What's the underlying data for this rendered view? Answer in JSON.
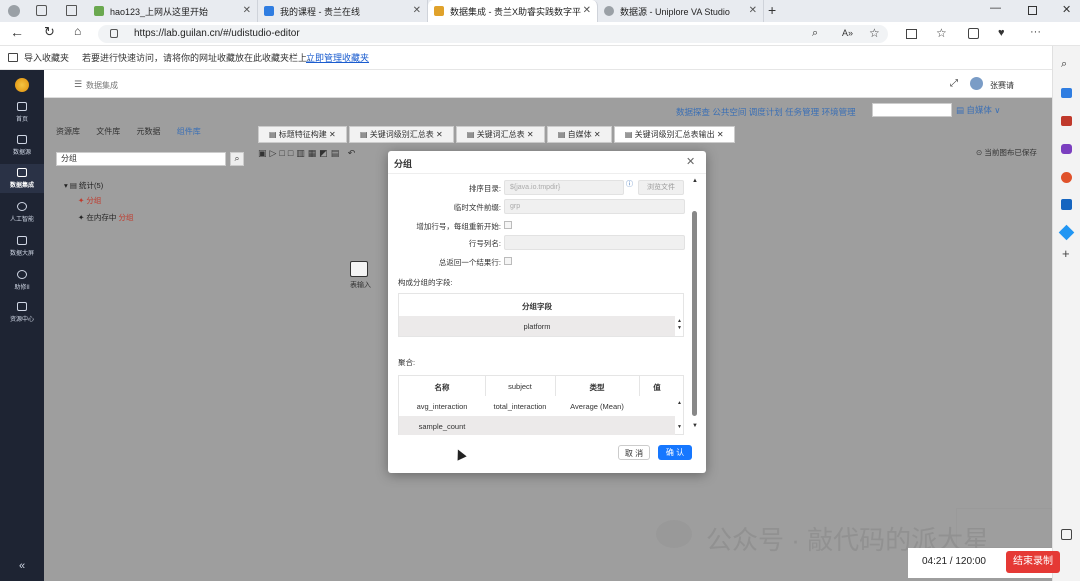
{
  "browser": {
    "tabs": [
      {
        "title": "hao123_上网从这里开始",
        "color": "#6aa84f",
        "active": false
      },
      {
        "title": "我的课程 - 贵兰在线",
        "color": "#2f7de1",
        "active": false
      },
      {
        "title": "数据集成 - 贵兰X助睿实践数字平",
        "color": "#e0a22b",
        "active": true
      },
      {
        "title": "数据源 - Uniplore VA Studio",
        "color": "#9aa0a6",
        "active": false
      }
    ],
    "url": "https://lab.guilan.cn/#/udistudio-editor",
    "favbar_import": "导入收藏夹",
    "favbar_hint": "若要进行快速访问，请将你的网址收藏放在此收藏夹栏上。",
    "favbar_link": "立即管理收藏夹"
  },
  "leftnav": {
    "items": [
      "首页",
      "数据源",
      "数据集成",
      "人工智能",
      "数据大屏",
      "助修II",
      "资源中心"
    ],
    "active": "数据集成"
  },
  "header": {
    "breadcrumb": "数据集成",
    "user": "张赛请"
  },
  "topmenu": {
    "items": [
      "数据探查",
      "公共空间",
      "调度计划",
      "任务管理",
      "环境管理"
    ],
    "media": "自媒体"
  },
  "side_tabs": [
    "资源库",
    "文件库",
    "元数据",
    "组件库"
  ],
  "search": {
    "value": "分组"
  },
  "tree": {
    "group": "统计(5)",
    "items": [
      {
        "label": "分组"
      },
      {
        "prefix": "在内存中",
        "label": "分组"
      }
    ]
  },
  "editor_tabs": [
    "标题特征构建",
    "关键词级别汇总表",
    "关键词汇总表",
    "自媒体",
    "关键词级别汇总表输出"
  ],
  "status": "当前图布已保存",
  "canvas_node": "表输入",
  "dialog": {
    "title": "分组",
    "sort_dir_label": "排序目录:",
    "sort_dir_value": "${java.io.tmpdir}",
    "browse": "浏览文件",
    "temp_prefix_label": "临时文件前缀:",
    "temp_prefix_value": "grp",
    "add_row_label": "增加行号，每组重新开始:",
    "row_col_label": "行号列名:",
    "always_one_label": "总返回一个结果行:",
    "group_fields_label": "构成分组的字段:",
    "group_header": "分组字段",
    "group_rows": [
      "platform"
    ],
    "agg_label": "聚合:",
    "agg_headers": [
      "名称",
      "subject",
      "类型",
      "值"
    ],
    "agg_rows": [
      [
        "avg_interaction",
        "total_interaction",
        "Average (Mean)",
        ""
      ],
      [
        "sample_count",
        "",
        "",
        ""
      ]
    ],
    "cancel": "取 消",
    "confirm": "确 认"
  },
  "watermark": "公众号 · 敲代码的派大星",
  "recording": {
    "time": "04:21 / 120:00",
    "stop": "结束录制"
  },
  "colors": {
    "accent": "#1677ff",
    "nav_bg": "#1e2433",
    "record": "#e53935",
    "menu_blue": "#3a6fb5"
  }
}
